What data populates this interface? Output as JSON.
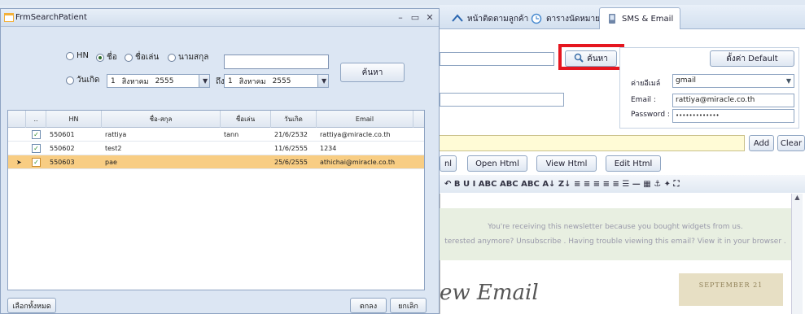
{
  "background": {
    "tabs": [
      {
        "label": "หน้าติดตามลูกค้า",
        "icon": "customer-icon"
      },
      {
        "label": "ตารางนัดหมาย",
        "icon": "calendar-icon"
      },
      {
        "label": "SMS & Email",
        "icon": "sms-icon"
      }
    ],
    "search_button": "ค้นหา",
    "default_button": "ตั้งค่า Default",
    "mail_account_label": "ค่ายอีเมล์",
    "mail_account_value": "gmail",
    "email_label": "Email :",
    "email_value": "rattiya@miracle.co.th",
    "password_label": "Password :",
    "password_value": "•••••••••••••",
    "add_button": "Add",
    "clear_button": "Clear",
    "html_buttons": [
      "nl",
      "Open Html",
      "View Html",
      "Edit Html"
    ],
    "toolbar_glyphs": "↶  B  U  I  ABC  ABC  ABC  A↓  Z↓  ≡  ≡  ≡  ≡  ≡  ☰  —  ▦  ⚓  ✦  ⛶",
    "newsletter_line1": "You're receiving this newsletter because you bought widgets from us.",
    "newsletter_line2": "terested anymore? Unsubscribe . Having trouble viewing this email? View it in your browser .",
    "newsletter_heading": "ew Email",
    "newsletter_date": "SEPTEMBER 21"
  },
  "dialog": {
    "title": "FrmSearchPatient",
    "search_by": [
      {
        "label": "HN",
        "selected": false
      },
      {
        "label": "ชื่อ",
        "selected": true
      },
      {
        "label": "ชื่อเล่น",
        "selected": false
      },
      {
        "label": "นามสกุล",
        "selected": false
      }
    ],
    "birthdate_label": "วันเกิด",
    "date_from": {
      "day": "1",
      "month": "สิงหาคม",
      "year": "2555"
    },
    "to_label": "ถึง",
    "date_to": {
      "day": "1",
      "month": "สิงหาคม",
      "year": "2555"
    },
    "search_value": "",
    "search_button": "ค้นหา",
    "grid": {
      "columns": [
        "..",
        "HN",
        "ชื่อ-สกุล",
        "ชื่อเล่น",
        "วันเกิด",
        "Email"
      ],
      "rows": [
        {
          "checked": true,
          "hn": "550601",
          "name": "rattiya",
          "nickname": "tann",
          "birthdate": "21/6/2532",
          "email": "rattiya@miracle.co.th",
          "selected": false
        },
        {
          "checked": true,
          "hn": "550602",
          "name": "test2",
          "nickname": "",
          "birthdate": "11/6/2555",
          "email": "1234",
          "selected": false
        },
        {
          "checked": true,
          "hn": "550603",
          "name": "pae",
          "nickname": "",
          "birthdate": "25/6/2555",
          "email": "athichai@miracle.co.th",
          "selected": true
        }
      ]
    },
    "select_all_button": "เลือกทั้งหมด",
    "ok_button": "ตกลง",
    "cancel_button": "ยกเลิก"
  }
}
